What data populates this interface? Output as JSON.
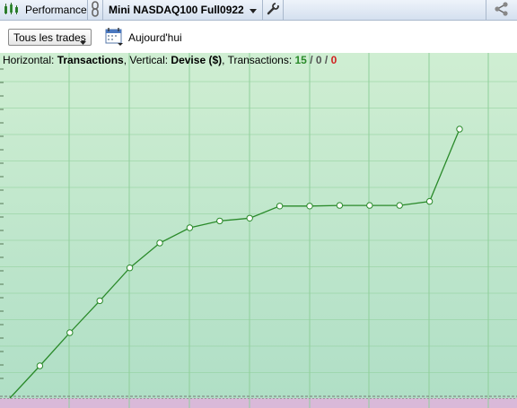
{
  "toolbar": {
    "performance_label": "Performance",
    "instrument_label": "Mini NASDAQ100 Full0922",
    "icons": [
      "chart-bars-icon",
      "link-icon",
      "chevron-down-icon",
      "wrench-icon",
      "share-icon"
    ]
  },
  "controls": {
    "trades_filter": "Tous les trades",
    "today_label": "Aujourd'hui"
  },
  "status": {
    "horizontal_prefix": "Horizontal: ",
    "horizontal_value": "Transactions",
    "vertical_prefix": ", Vertical: ",
    "vertical_value": "Devise ($)",
    "transactions_prefix": ", Transactions: ",
    "count_total": "15",
    "sep1": " / ",
    "count_even": "0",
    "sep2": " / ",
    "count_loss": "0"
  },
  "colors": {
    "line": "#2a8a2a",
    "positive_bg_top": "#cdeed0",
    "positive_bg_bottom": "#b2e0c8",
    "negative_bg": "#d8b8d8",
    "grid": "#8fcf9a"
  },
  "chart_data": {
    "type": "line",
    "x": [
      0,
      1,
      2,
      3,
      4,
      5,
      6,
      7,
      8,
      9,
      10,
      11,
      12,
      13,
      14,
      15
    ],
    "y": [
      0,
      1.04,
      2.11,
      3.14,
      4.2,
      5.0,
      5.49,
      5.71,
      5.8,
      6.19,
      6.19,
      6.21,
      6.21,
      6.21,
      6.34,
      8.67
    ],
    "grid": true,
    "title": "",
    "xlabel": "",
    "ylabel": ""
  }
}
